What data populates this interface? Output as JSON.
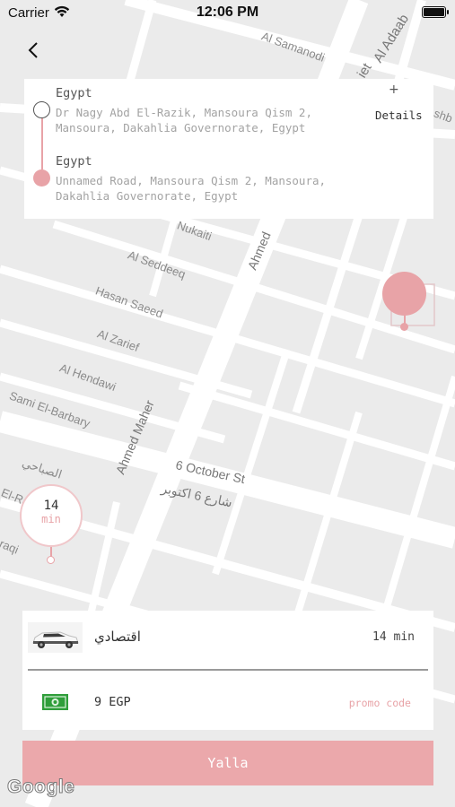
{
  "status_bar": {
    "carrier": "Carrier",
    "time": "12:06 PM"
  },
  "map": {
    "streets": [
      "Al Samanodi",
      "Al Adaab",
      "Nukaiti",
      "Ahmed",
      "Al Seddeeq",
      "Hasan Saeed",
      "Al Zarief",
      "Al Hendawi",
      "Sami El-Barbary",
      "Ahmed Maher",
      "6 October St",
      "شارع 6 اكتوبر",
      "الصباحي",
      "El-Ra",
      "raqi",
      "shb",
      "iet"
    ],
    "watermark": "Google"
  },
  "trip": {
    "origin": {
      "title": "Egypt",
      "address": "Dr Nagy Abd El-Razik, Mansoura Qism 2, Mansoura, Dakahlia Governorate, Egypt"
    },
    "destination": {
      "title": "Egypt",
      "address": "Unnamed Road, Mansoura Qism 2, Mansoura, Dakahlia Governorate, Egypt"
    },
    "plus_label": "+",
    "details_label": "Details"
  },
  "origin_pin": {
    "value": "14",
    "unit": "min"
  },
  "ride": {
    "name": "اقتصادي",
    "eta": "14 min",
    "fare": "9 EGP",
    "promo_label": "promo code"
  },
  "action": {
    "yalla_label": "Yalla"
  },
  "colors": {
    "accent": "#e8a3a7",
    "button": "#eba8ab",
    "map_bg": "#ebebeb",
    "road": "#ffffff"
  },
  "icons": [
    "back-chevron-icon",
    "wifi-icon",
    "battery-icon",
    "car-icon",
    "cash-icon"
  ]
}
